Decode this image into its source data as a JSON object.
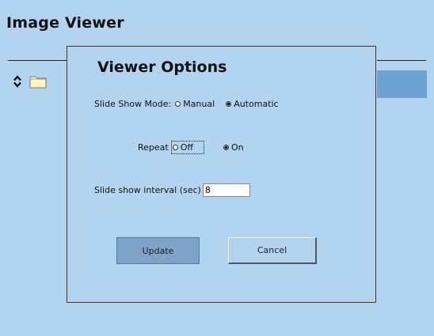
{
  "app": {
    "title": "Image Viewer"
  },
  "colors": {
    "background": "#b3d4f1",
    "selection_stripe": "#6ea3d6",
    "update_button": "#7ea3c8"
  },
  "icons": {
    "nav": "up-down-arrows-icon",
    "folder": "folder-icon"
  },
  "dialog": {
    "title": "Viewer Options",
    "slide_show_mode": {
      "label": "Slide Show Mode:",
      "options": [
        "Manual",
        "Automatic"
      ],
      "selected": "Automatic"
    },
    "repeat": {
      "label": "Repeat",
      "options": [
        "Off",
        "On"
      ],
      "selected": "On"
    },
    "interval": {
      "label": "Slide show interval (sec)",
      "value": "8"
    },
    "buttons": {
      "update": "Update",
      "cancel": "Cancel"
    }
  }
}
